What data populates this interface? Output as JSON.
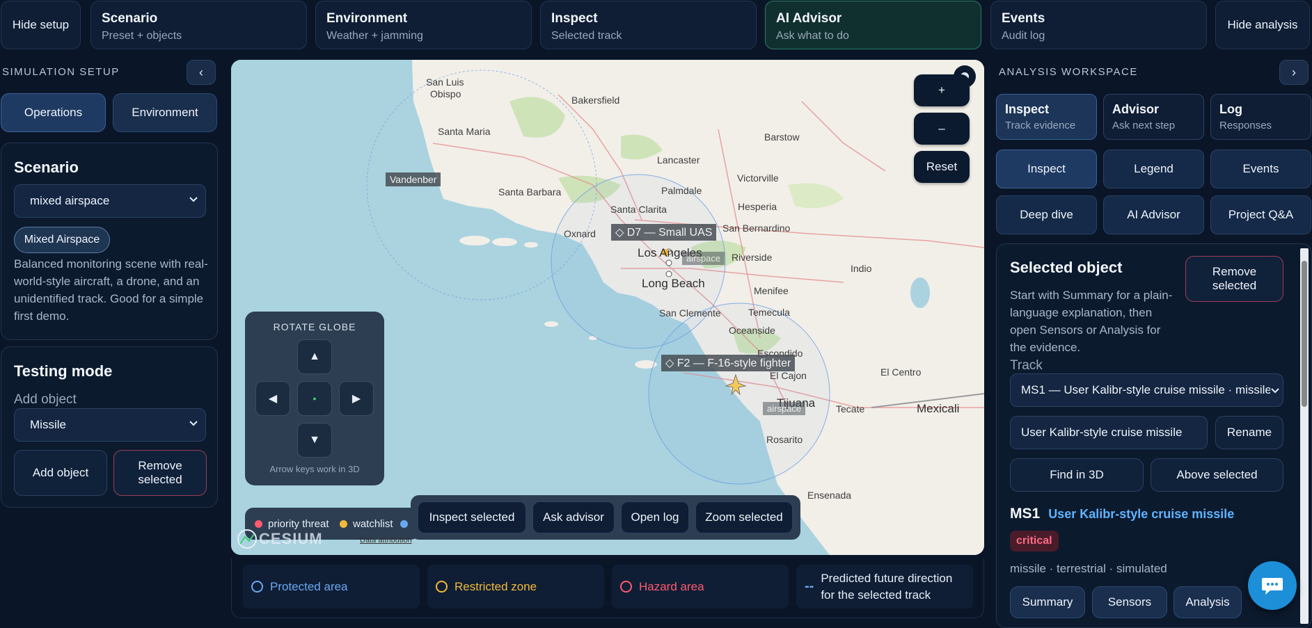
{
  "topbar": {
    "hide_setup": "Hide setup",
    "hide_analysis": "Hide analysis",
    "cards": [
      {
        "title": "Scenario",
        "subtitle": "Preset + objects"
      },
      {
        "title": "Environment",
        "subtitle": "Weather + jamming"
      },
      {
        "title": "Inspect",
        "subtitle": "Selected track"
      },
      {
        "title": "AI Advisor",
        "subtitle": "Ask what to do"
      },
      {
        "title": "Events",
        "subtitle": "Audit log"
      }
    ]
  },
  "left": {
    "section_label": "SIMULATION SETUP",
    "collapse_glyph": "‹",
    "tabs": [
      "Operations",
      "Environment"
    ],
    "scenario": {
      "heading": "Scenario",
      "select_value": "mixed airspace",
      "chip": "Mixed Airspace",
      "description": "Balanced monitoring scene with real-world-style aircraft, a drone, and an unidentified track. Good for a simple first demo."
    },
    "testing": {
      "heading": "Testing mode",
      "add_label": "Add object",
      "select_value": "Missile",
      "add_button": "Add object",
      "remove_button": "Remove selected"
    }
  },
  "map": {
    "zoom_in": "+",
    "zoom_out": "–",
    "reset": "Reset",
    "rotate": {
      "title": "ROTATE GLOBE",
      "hint": "Arrow keys work in 3D",
      "up": "▲",
      "down": "▼",
      "left": "◀",
      "right": "▶",
      "center": "●"
    },
    "legend": [
      {
        "label": "priority threat",
        "color": "#ff5a6e"
      },
      {
        "label": "watchlist",
        "color": "#f5b93a"
      }
    ],
    "actions": [
      "Inspect selected",
      "Ask advisor",
      "Open log",
      "Zoom selected"
    ],
    "attribution": "Data attribution",
    "cesium": "CESIUM",
    "track_labels": {
      "d7": "◇ D7 — Small UAS",
      "f2": "◇ F2 — F-16-style fighter",
      "vandenberg": "Vandenber",
      "airspace1": "airspace",
      "airspace2": "airspace"
    },
    "places": {
      "san_luis": "San Luis",
      "obispo": "Obispo",
      "bakersfield": "Bakersfield",
      "santa_maria": "Santa Maria",
      "barstow": "Barstow",
      "lancaster": "Lancaster",
      "victorville": "Victorville",
      "santa_barbara": "Santa Barbara",
      "palmdale": "Palmdale",
      "hesperia": "Hesperia",
      "santa_clarita": "Santa Clarita",
      "oxnard": "Oxnard",
      "san_bernardino": "San Bernardino",
      "los_angeles": "Los Angeles",
      "riverside": "Riverside",
      "indio": "Indio",
      "long_beach": "Long Beach",
      "menifee": "Menifee",
      "san_clemente": "San Clemente",
      "temecula": "Temecula",
      "oceanside": "Oceanside",
      "escondido": "Escondido",
      "el_centro": "El Centro",
      "el_cajon": "El Cajon",
      "tijuana": "Tijuana",
      "mexicali": "Mexicali",
      "tecate": "Tecate",
      "rosarito": "Rosarito",
      "ensenada": "Ensenada"
    }
  },
  "bottom_legend": [
    {
      "label": "Protected area",
      "color": "#6aa8f0"
    },
    {
      "label": "Restricted zone",
      "color": "#f5b93a"
    },
    {
      "label": "Hazard area",
      "color": "#ff5a6e"
    },
    {
      "label": "Predicted future direction for the selected track",
      "color": "#6aa8f0"
    }
  ],
  "right": {
    "section_label": "ANALYSIS WORKSPACE",
    "collapse_glyph": "›",
    "tabs": [
      {
        "title": "Inspect",
        "subtitle": "Track evidence"
      },
      {
        "title": "Advisor",
        "subtitle": "Ask next step"
      },
      {
        "title": "Log",
        "subtitle": "Responses"
      }
    ],
    "grid": [
      "Inspect",
      "Legend",
      "Events",
      "Deep dive",
      "AI Advisor",
      "Project Q&A"
    ],
    "selected": {
      "heading": "Selected object",
      "remove": "Remove selected",
      "intro": "Start with Summary for a plain-language explanation, then open Sensors or Analysis for the evidence.",
      "track_label": "Track",
      "track_value": "MS1 — User Kalibr-style cruise missile · missile",
      "name_value": "User Kalibr-style cruise missile",
      "rename": "Rename",
      "find_3d": "Find in 3D",
      "above": "Above selected",
      "id": "MS1",
      "name": "User Kalibr-style cruise missile",
      "severity": "critical",
      "meta": "missile · terrestrial · simulated",
      "subtabs": [
        "Summary",
        "Sensors",
        "Analysis"
      ]
    }
  }
}
